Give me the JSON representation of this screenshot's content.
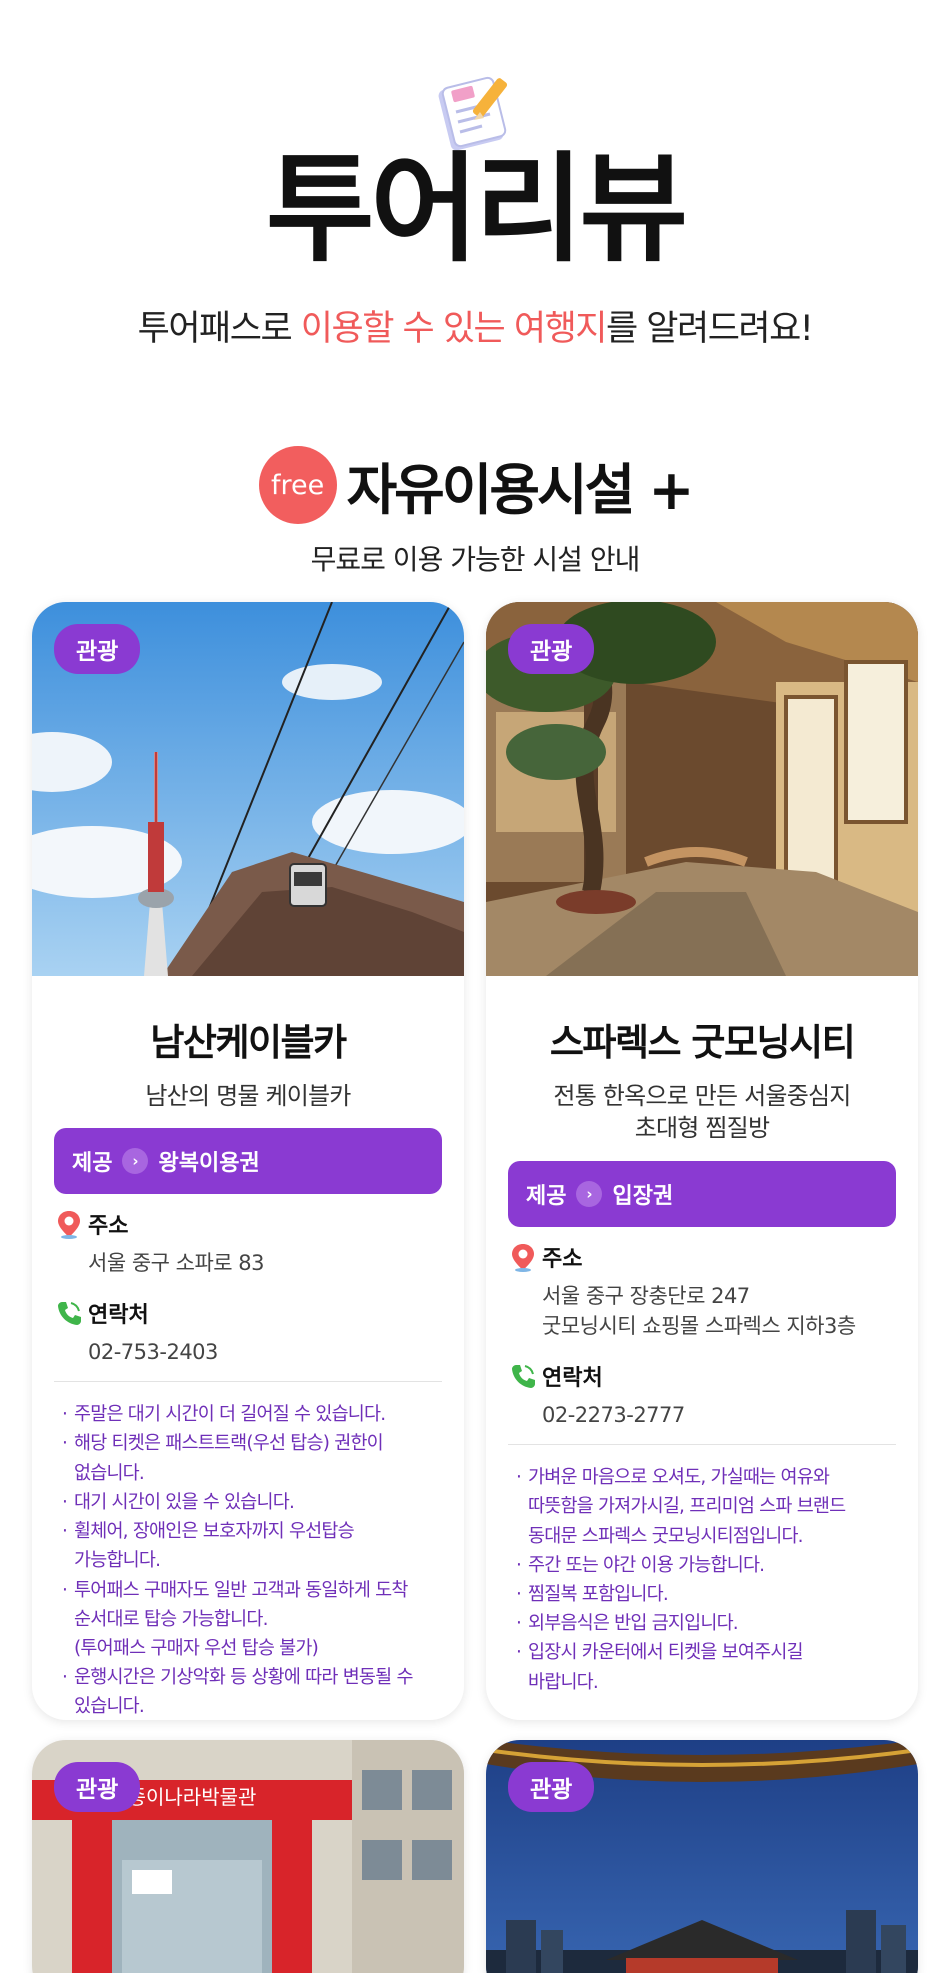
{
  "header": {
    "title": "투어리뷰",
    "subtitle_pre": "투어패스로 ",
    "subtitle_highlight1": "이용할 수 있는 여행지",
    "subtitle_post": "를 알려드려요!"
  },
  "section": {
    "badge": "free",
    "title": "자유이용시설 +",
    "subtitle": "무료로 이용 가능한 시설 안내"
  },
  "labels": {
    "provide": "제공",
    "address": "주소",
    "contact": "연락처"
  },
  "cards": [
    {
      "category": "관광",
      "name": "남산케이블카",
      "desc1": "남산의 명물 케이블카",
      "desc2": "",
      "provide_value": "왕복이용권",
      "address1": "서울 중구 소파로 83",
      "address2": "",
      "phone": "02-753-2403",
      "notes": [
        "주말은 대기 시간이 더 길어질 수 있습니다.",
        "해당 티켓은 패스트트랙(우선 탑승) 권한이",
        "없습니다.",
        "대기 시간이 있을 수 있습니다.",
        "휠체어, 장애인은 보호자까지 우선탑승",
        "가능합니다.",
        "투어패스 구매자도 일반 고객과 동일하게 도착",
        "순서대로 탑승 가능합니다.",
        "(투어패스 구매자 우선 탑승 불가)",
        "운행시간은 기상악화 등 상황에 따라 변동될 수",
        "있습니다."
      ]
    },
    {
      "category": "관광",
      "name": "스파렉스 굿모닝시티",
      "desc1": "전통 한옥으로 만든 서울중심지",
      "desc2": "초대형 찜질방",
      "provide_value": "입장권",
      "address1": "서울 중구 장충단로 247",
      "address2": "굿모닝시티 쇼핑몰 스파렉스 지하3층",
      "phone": "02-2273-2777",
      "notes": [
        "가벼운 마음으로 오셔도, 가실때는 여유와",
        "따뜻함을 가져가시길, 프리미엄 스파 브랜드",
        "동대문 스파렉스 굿모닝시티점입니다.",
        "주간 또는 야간 이용 가능합니다.",
        "찜질복 포함입니다.",
        "외부음식은 반입 금지입니다.",
        "입장시 카운터에서 티켓을 보여주시길",
        "바랍니다."
      ]
    },
    {
      "category": "관광",
      "sign": "종이나라박물관"
    },
    {
      "category": "관광"
    }
  ],
  "colors": {
    "accent_purple": "#8a3ad2",
    "highlight_red": "#f05a5a",
    "note_purple": "#6f2fb8"
  }
}
